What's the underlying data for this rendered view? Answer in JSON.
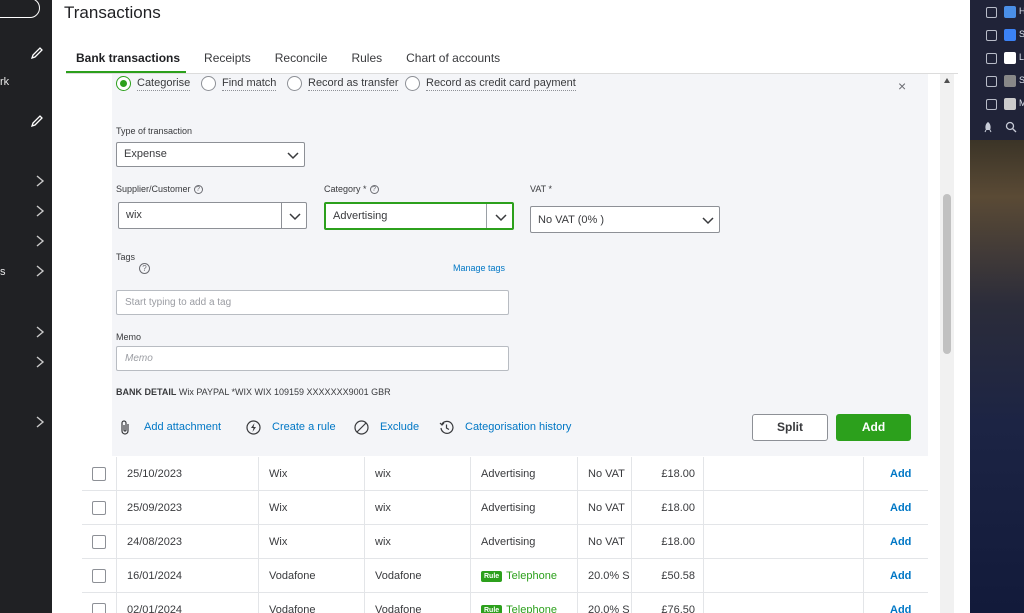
{
  "page": {
    "title": "Transactions"
  },
  "left_sidebar": {
    "item_fragments": [
      "rk",
      "s"
    ]
  },
  "tabs": [
    {
      "label": "Bank transactions",
      "active": true
    },
    {
      "label": "Receipts"
    },
    {
      "label": "Reconcile"
    },
    {
      "label": "Rules"
    },
    {
      "label": "Chart of accounts"
    }
  ],
  "form": {
    "modes": [
      {
        "label": "Categorise",
        "selected": true
      },
      {
        "label": "Find match"
      },
      {
        "label": "Record as transfer"
      },
      {
        "label": "Record as credit card payment"
      }
    ],
    "close_symbol": "×",
    "type_label": "Type of transaction",
    "type_value": "Expense",
    "supplier_label": "Supplier/Customer",
    "supplier_value": "wix",
    "category_label": "Category *",
    "category_value": "Advertising",
    "vat_label": "VAT *",
    "vat_value": "No VAT (0% )",
    "tags_label": "Tags",
    "manage_tags": "Manage tags",
    "tags_placeholder": "Start typing to add a tag",
    "memo_label": "Memo",
    "memo_placeholder": "Memo",
    "bank_detail_label": "BANK DETAIL",
    "bank_detail_value": "Wix PAYPAL *WIX WIX 109159 XXXXXXX9001 GBR",
    "actions": {
      "attachment": "Add attachment",
      "rule": "Create a rule",
      "exclude": "Exclude",
      "history": "Categorisation history"
    },
    "split_label": "Split",
    "add_label": "Add"
  },
  "rows": [
    {
      "date": "25/10/2023",
      "desc": "Wix",
      "payee": "wix",
      "category": "Advertising",
      "rule": false,
      "vat": "No VAT",
      "amount": "£18.00",
      "action": "Add"
    },
    {
      "date": "25/09/2023",
      "desc": "Wix",
      "payee": "wix",
      "category": "Advertising",
      "rule": false,
      "vat": "No VAT",
      "amount": "£18.00",
      "action": "Add"
    },
    {
      "date": "24/08/2023",
      "desc": "Wix",
      "payee": "wix",
      "category": "Advertising",
      "rule": false,
      "vat": "No VAT",
      "amount": "£18.00",
      "action": "Add"
    },
    {
      "date": "16/01/2024",
      "desc": "Vodafone",
      "payee": "Vodafone",
      "category": "Telephone",
      "rule": true,
      "vat": "20.0% S",
      "amount": "£50.58",
      "action": "Add"
    },
    {
      "date": "02/01/2024",
      "desc": "Vodafone",
      "payee": "Vodafone",
      "category": "Telephone",
      "rule": true,
      "vat": "20.0% S",
      "amount": "£76.50",
      "action": "Add"
    }
  ],
  "rule_badge": "Rule",
  "right_strip": {
    "items": [
      {
        "text": "H",
        "icon": "bookmark-icon",
        "color": "#4a8fe7"
      },
      {
        "text": "S",
        "icon": "s-app-icon",
        "color": "#3b82f6"
      },
      {
        "text": "L",
        "icon": "circle-app-icon",
        "color": "#ffffff"
      },
      {
        "text": "S",
        "icon": "settings-app-icon",
        "color": "#888888"
      },
      {
        "text": "M",
        "icon": "person-app-icon",
        "color": "#cccccc"
      }
    ]
  },
  "colors": {
    "accent": "#2ca01c",
    "link": "#0077c5",
    "panel": "#f4f5f8",
    "sidebar": "#202124"
  }
}
